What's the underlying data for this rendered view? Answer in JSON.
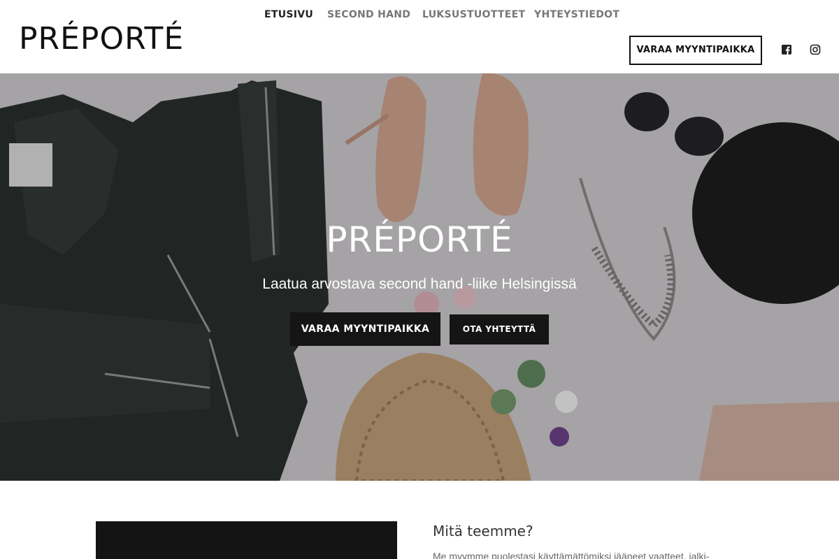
{
  "header": {
    "logo": "PRÉPORTÉ",
    "nav": [
      {
        "label": "ETUSIVU",
        "active": true
      },
      {
        "label": "SECOND HAND",
        "active": false
      },
      {
        "label": "LUKSUSTUOTTEET",
        "active": false
      },
      {
        "label": "YHTEYSTIEDOT",
        "active": false
      }
    ],
    "cta_label": "VARAA MYYNTIPAIKKA",
    "social_icons": [
      "facebook-icon",
      "instagram-icon"
    ]
  },
  "hero": {
    "title": "PRÉPORTÉ",
    "subtitle": "Laatua arvostava second hand -liike Helsingissä",
    "primary_button": "VARAA MYYNTIPAIKKA",
    "secondary_button": "OTA YHTEYTTÄ"
  },
  "section": {
    "title": "Mitä teemme?",
    "text": "Me myymme puolestasi käyttämättömiksi jääneet vaatteet, jalki-"
  },
  "colors": {
    "text_dark": "#111111",
    "nav_muted": "#777777",
    "button_dark": "#151515",
    "hero_bg": "#cfcdce"
  }
}
